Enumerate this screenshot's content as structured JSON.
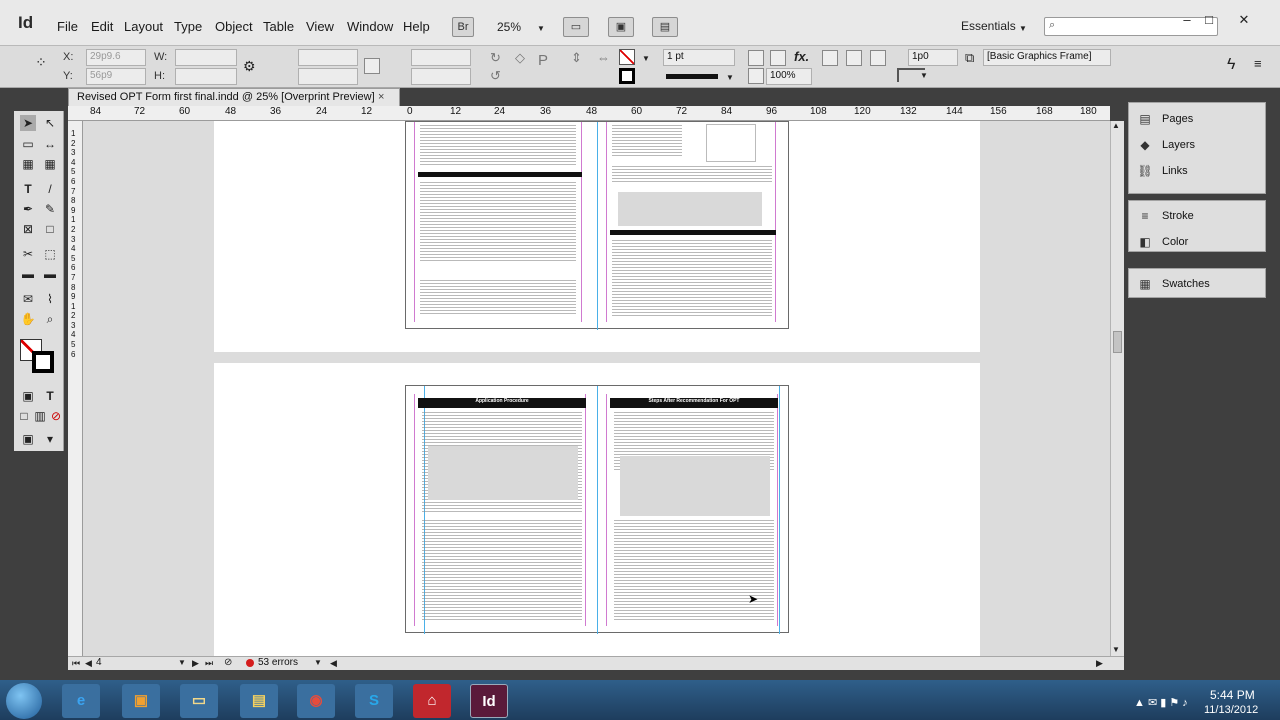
{
  "app": {
    "logo": "Id"
  },
  "menubar": {
    "items": [
      "File",
      "Edit",
      "Layout",
      "Type",
      "Object",
      "Table",
      "View",
      "Window",
      "Help"
    ],
    "bridge": "Br",
    "zoom": "25%",
    "workspace": "Essentials"
  },
  "control": {
    "x_label": "X:",
    "x_value": "29p9.6",
    "y_label": "Y:",
    "y_value": "56p9",
    "w_label": "W:",
    "h_label": "H:",
    "stroke_weight": "1 pt",
    "opacity": "100%",
    "gap": "1p0",
    "object_style": "[Basic Graphics Frame]"
  },
  "document": {
    "tab_title": "Revised OPT Form first final.indd @ 25% [Overprint Preview]",
    "close": "×",
    "ruler_ticks": [
      "84",
      "72",
      "60",
      "48",
      "36",
      "24",
      "12",
      "0",
      "12",
      "24",
      "36",
      "48",
      "60",
      "72",
      "84",
      "96",
      "108",
      "120",
      "132",
      "144",
      "156",
      "168",
      "180"
    ],
    "vruler_ticks": [
      "1",
      "2",
      "3",
      "4",
      "5",
      "6",
      "7",
      "8",
      "9",
      "1",
      "2",
      "3",
      "4",
      "5",
      "6",
      "7",
      "8",
      "9",
      "1",
      "2",
      "3",
      "4",
      "5",
      "6"
    ]
  },
  "spread_bottom": {
    "left_title": "Application Procedure",
    "right_title": "Steps After Recommendation For OPT"
  },
  "status": {
    "page": "4",
    "errors": "53 errors"
  },
  "panels": {
    "group1": [
      "Pages",
      "Layers",
      "Links"
    ],
    "group2": [
      "Stroke",
      "Color"
    ],
    "group3": [
      "Swatches"
    ]
  },
  "clock": {
    "time": "5:44 PM",
    "date": "11/13/2012"
  }
}
